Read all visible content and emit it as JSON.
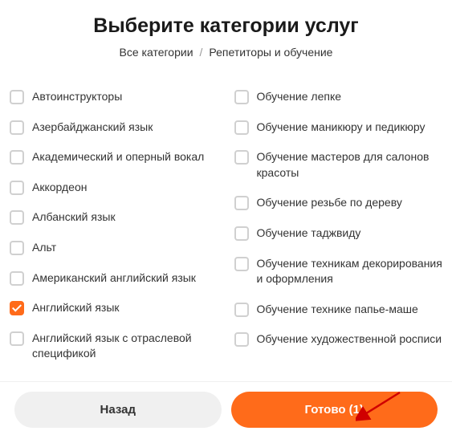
{
  "header": {
    "title": "Выберите категории услуг",
    "breadcrumb": {
      "root": "Все категории",
      "current": "Репетиторы и обучение"
    }
  },
  "columns": {
    "left": [
      {
        "label": "Автоинструкторы",
        "checked": false
      },
      {
        "label": "Азербайджанский язык",
        "checked": false
      },
      {
        "label": "Академический и оперный вокал",
        "checked": false
      },
      {
        "label": "Аккордеон",
        "checked": false
      },
      {
        "label": "Албанский язык",
        "checked": false
      },
      {
        "label": "Альт",
        "checked": false
      },
      {
        "label": "Американский английский язык",
        "checked": false
      },
      {
        "label": "Английский язык",
        "checked": true
      },
      {
        "label": "Английский язык с отраслевой спецификой",
        "checked": false
      }
    ],
    "right": [
      {
        "label": "Обучение лепке",
        "checked": false
      },
      {
        "label": "Обучение маникюру и педикюру",
        "checked": false
      },
      {
        "label": "Обучение мастеров для салонов красоты",
        "checked": false
      },
      {
        "label": "Обучение резьбе по дереву",
        "checked": false
      },
      {
        "label": "Обучение таджвиду",
        "checked": false
      },
      {
        "label": "Обучение техникам декорирования и оформления",
        "checked": false
      },
      {
        "label": "Обучение технике папье-маше",
        "checked": false
      },
      {
        "label": "Обучение художественной росписи",
        "checked": false
      }
    ]
  },
  "footer": {
    "back_label": "Назад",
    "done_label": "Готово (1)"
  }
}
